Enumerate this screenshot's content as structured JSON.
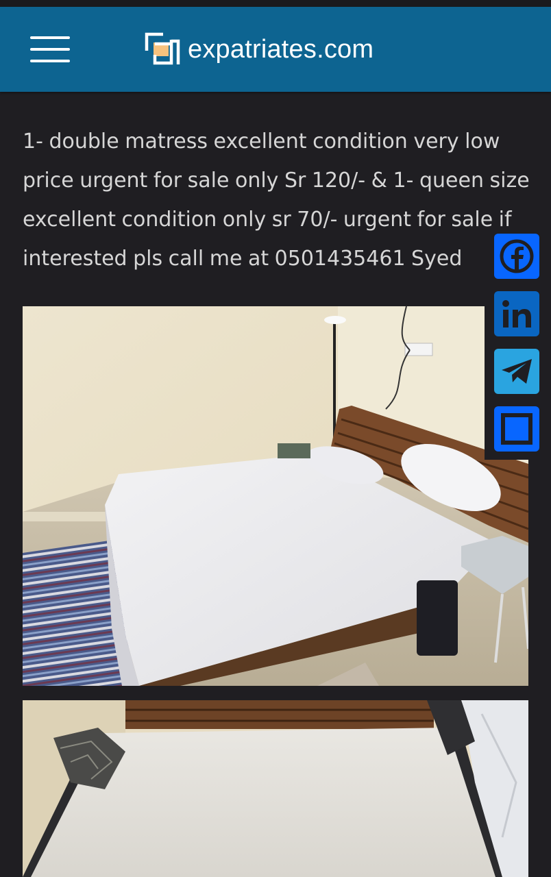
{
  "header": {
    "site_name": "expatriates.com",
    "menu_icon": "hamburger-menu-icon",
    "logo_icon": "expatriates-logo-icon",
    "colors": {
      "header_bg": "#0d6491",
      "page_bg": "#1f1e22",
      "text": "#d6d6d6"
    }
  },
  "listing": {
    "description_lines": [
      "1- double matress excellent condition very low",
      "price urgent for sale only Sr 120/- & 1- queen size",
      "excellent condition only sr 70/- urgent for sale if",
      "interested pls call me at 0501435461 Syed"
    ],
    "photos": [
      {
        "alt": "bed-with-white-sheets-photo"
      },
      {
        "alt": "mattress-photo"
      }
    ]
  },
  "share": {
    "buttons": [
      {
        "name": "Facebook",
        "icon": "facebook-icon",
        "color": "#0866ff"
      },
      {
        "name": "LinkedIn",
        "icon": "linkedin-icon",
        "color": "#0a66c2"
      },
      {
        "name": "Telegram",
        "icon": "telegram-icon",
        "color": "#2aa4e0"
      },
      {
        "name": "Share",
        "icon": "share-square-icon",
        "color": "#0866ff"
      }
    ]
  }
}
